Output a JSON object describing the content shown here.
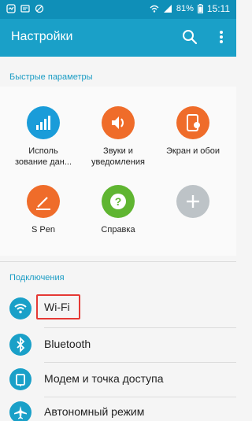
{
  "status_bar": {
    "battery": "81%",
    "time": "15:11",
    "left_icons": [
      "notification-icon",
      "message-icon",
      "block-icon"
    ],
    "right_icons": [
      "wifi-icon",
      "signal-icon",
      "battery-icon"
    ]
  },
  "app_bar": {
    "title": "Настройки",
    "search_icon": "search-icon",
    "more_icon": "more-vert-icon"
  },
  "quick_settings": {
    "header": "Быстрые параметры",
    "tiles": [
      {
        "label_line1": "Исполь",
        "label_line2": "зование дан...",
        "icon": "data-usage-icon",
        "color": "#1a9cd9"
      },
      {
        "label_line1": "Звуки и",
        "label_line2": "уведомления",
        "icon": "volume-icon",
        "color": "#ef6c2a"
      },
      {
        "label_line1": "Экран и обои",
        "label_line2": "",
        "icon": "display-icon",
        "color": "#ef6c2a"
      },
      {
        "label_line1": "S Pen",
        "label_line2": "",
        "icon": "pen-icon",
        "color": "#ef6c2a"
      },
      {
        "label_line1": "Справка",
        "label_line2": "",
        "icon": "help-icon",
        "color": "#5fb531"
      },
      {
        "label_line1": "",
        "label_line2": "",
        "icon": "add-icon",
        "color": "#bdc3c7"
      }
    ]
  },
  "connections": {
    "header": "Подключения",
    "items": [
      {
        "label": "Wi-Fi",
        "icon": "wifi-icon"
      },
      {
        "label": "Bluetooth",
        "icon": "bluetooth-icon"
      },
      {
        "label": "Модем и точка доступа",
        "icon": "tethering-icon"
      },
      {
        "label": "Автономный режим",
        "icon": "airplane-icon"
      }
    ]
  },
  "colors": {
    "status_bar": "#0f8fb8",
    "app_bar": "#1aa0c8",
    "accent": "#1a9cc4",
    "highlight": "#e53935"
  }
}
